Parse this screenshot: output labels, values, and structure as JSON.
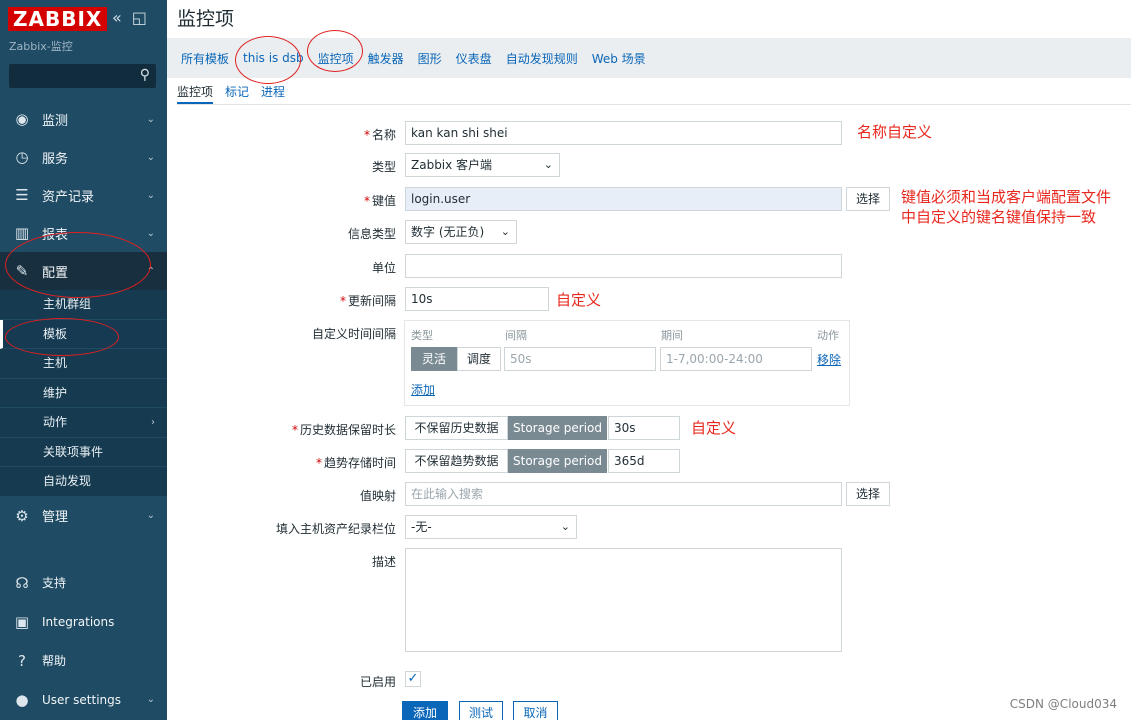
{
  "sidebar": {
    "logo": "ZABBIX",
    "instance": "Zabbix-监控",
    "search_value": "",
    "nav": [
      {
        "label": "监测",
        "icon": "eye-icon"
      },
      {
        "label": "服务",
        "icon": "clock-icon"
      },
      {
        "label": "资产记录",
        "icon": "list-icon"
      },
      {
        "label": "报表",
        "icon": "bar-chart-icon"
      },
      {
        "label": "配置",
        "icon": "wrench-icon"
      }
    ],
    "config_sub": [
      "主机群组",
      "模板",
      "主机",
      "维护",
      "动作",
      "关联项事件",
      "自动发现"
    ],
    "admin": "管理",
    "bottom": [
      {
        "label": "支持",
        "icon": "headset-icon"
      },
      {
        "label": "Integrations",
        "icon": "zabbix-z-icon"
      },
      {
        "label": "帮助",
        "icon": "question-icon"
      },
      {
        "label": "User settings",
        "icon": "user-icon"
      }
    ]
  },
  "page": {
    "title": "监控项",
    "breadcrumb": [
      "所有模板",
      "this is dsb",
      "监控项",
      "触发器",
      "图形",
      "仪表盘",
      "自动发现规则",
      "Web 场景"
    ],
    "tabs": [
      "监控项",
      "标记",
      "进程"
    ]
  },
  "form": {
    "name_label": "名称",
    "name_value": "kan kan shi shei",
    "type_label": "类型",
    "type_value": "Zabbix 客户端",
    "key_label": "键值",
    "key_value": "login.user",
    "select_btn": "选择",
    "info_type_label": "信息类型",
    "info_type_value": "数字 (无正负)",
    "unit_label": "单位",
    "unit_value": "",
    "interval_label": "更新间隔",
    "interval_value": "10s",
    "custom_interval_label": "自定义时间间隔",
    "ci_headers": {
      "type": "类型",
      "interval": "间隔",
      "period": "期间",
      "action": "动作"
    },
    "ci_flexible": "灵活",
    "ci_scheduling": "调度",
    "ci_interval_ph": "50s",
    "ci_period_ph": "1-7,00:00-24:00",
    "ci_remove": "移除",
    "ci_add": "添加",
    "history_label": "历史数据保留时长",
    "history_no_keep": "不保留历史数据",
    "storage_period": "Storage period",
    "history_value": "30s",
    "trends_label": "趋势存储时间",
    "trends_no_keep": "不保留趋势数据",
    "trends_value": "365d",
    "valuemap_label": "值映射",
    "valuemap_ph": "在此输入搜索",
    "inventory_label": "填入主机资产纪录栏位",
    "inventory_value": "-无-",
    "desc_label": "描述",
    "desc_value": "",
    "enabled_label": "已启用",
    "btn_add": "添加",
    "btn_test": "测试",
    "btn_cancel": "取消"
  },
  "annotations": {
    "name": "名称自定义",
    "key_line1": "键值必须和当成客户端配置文件",
    "key_line2": "中自定义的键名键值保持一致",
    "interval": "自定义",
    "history": "自定义"
  },
  "watermark": "CSDN @Cloud034"
}
